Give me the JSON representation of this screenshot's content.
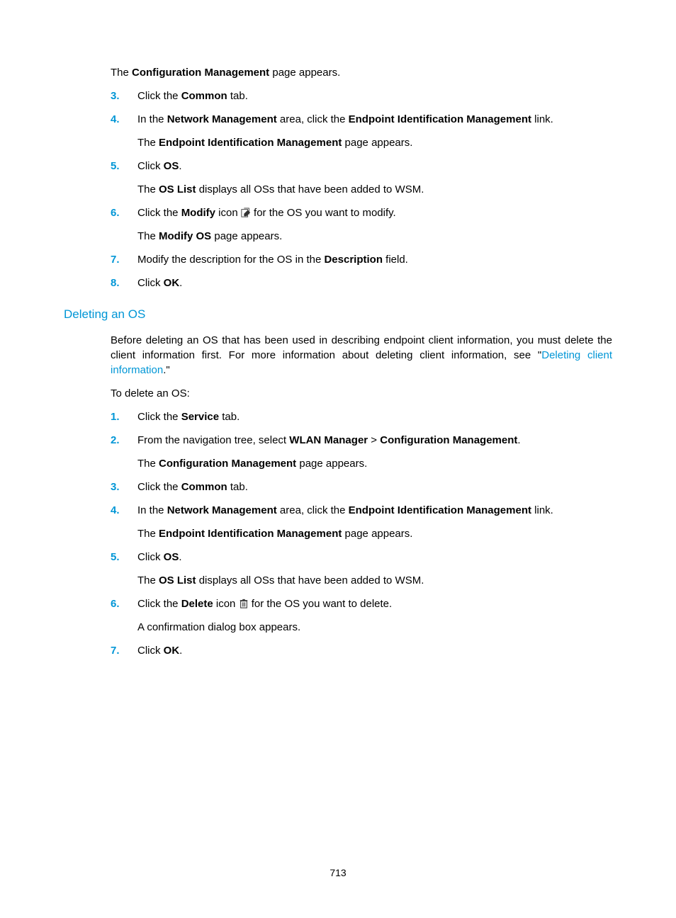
{
  "section1": {
    "pre_result": [
      "The ",
      "Configuration Management",
      " page appears."
    ],
    "items": [
      {
        "num": "3.",
        "text": [
          [
            "Click the ",
            "Common",
            " tab."
          ]
        ]
      },
      {
        "num": "4.",
        "text": [
          [
            "In the ",
            "Network Management",
            " area, click the ",
            "Endpoint Identification Management",
            " link."
          ],
          [
            "The ",
            "Endpoint Identification Management",
            " page appears."
          ]
        ]
      },
      {
        "num": "5.",
        "text": [
          [
            "Click ",
            "OS",
            "."
          ],
          [
            "The ",
            "OS List",
            " displays all OSs that have been added to WSM."
          ]
        ]
      },
      {
        "num": "6.",
        "text": [
          [
            "Click the ",
            "Modify",
            " icon ",
            "[icon:modify]",
            " for the OS you want to modify."
          ],
          [
            "The ",
            "Modify OS",
            " page appears."
          ]
        ]
      },
      {
        "num": "7.",
        "text": [
          [
            "Modify the description for the OS in the ",
            "Description",
            " field."
          ]
        ]
      },
      {
        "num": "8.",
        "text": [
          [
            "Click ",
            "OK",
            "."
          ]
        ]
      }
    ]
  },
  "heading": "Deleting an OS",
  "intro": {
    "p1_pre": "Before deleting an OS that has been used in describing endpoint client information, you must delete the client information first. For more information about deleting client information, see \"",
    "link": "Deleting client information",
    "p1_post": ".\"",
    "p2": "To delete an OS:"
  },
  "section2": {
    "items": [
      {
        "num": "1.",
        "text": [
          [
            "Click the ",
            "Service",
            " tab."
          ]
        ]
      },
      {
        "num": "2.",
        "text": [
          [
            "From the navigation tree, select ",
            "WLAN Manager",
            " > ",
            "Configuration Management",
            "."
          ],
          [
            "The ",
            "Configuration Management",
            " page appears."
          ]
        ]
      },
      {
        "num": "3.",
        "text": [
          [
            "Click the ",
            "Common",
            " tab."
          ]
        ]
      },
      {
        "num": "4.",
        "text": [
          [
            "In the ",
            "Network Management",
            " area, click the ",
            "Endpoint Identification Management",
            " link."
          ],
          [
            "The ",
            "Endpoint Identification Management",
            " page appears."
          ]
        ]
      },
      {
        "num": "5.",
        "text": [
          [
            "Click ",
            "OS",
            "."
          ],
          [
            "The ",
            "OS List",
            " displays all OSs that have been added to WSM."
          ]
        ]
      },
      {
        "num": "6.",
        "text": [
          [
            "Click the ",
            "Delete",
            " icon ",
            "[icon:delete]",
            " for the OS you want to delete."
          ],
          [
            "A confirmation dialog box appears."
          ]
        ]
      },
      {
        "num": "7.",
        "text": [
          [
            "Click ",
            "OK",
            "."
          ]
        ]
      }
    ]
  },
  "page_number": "713"
}
